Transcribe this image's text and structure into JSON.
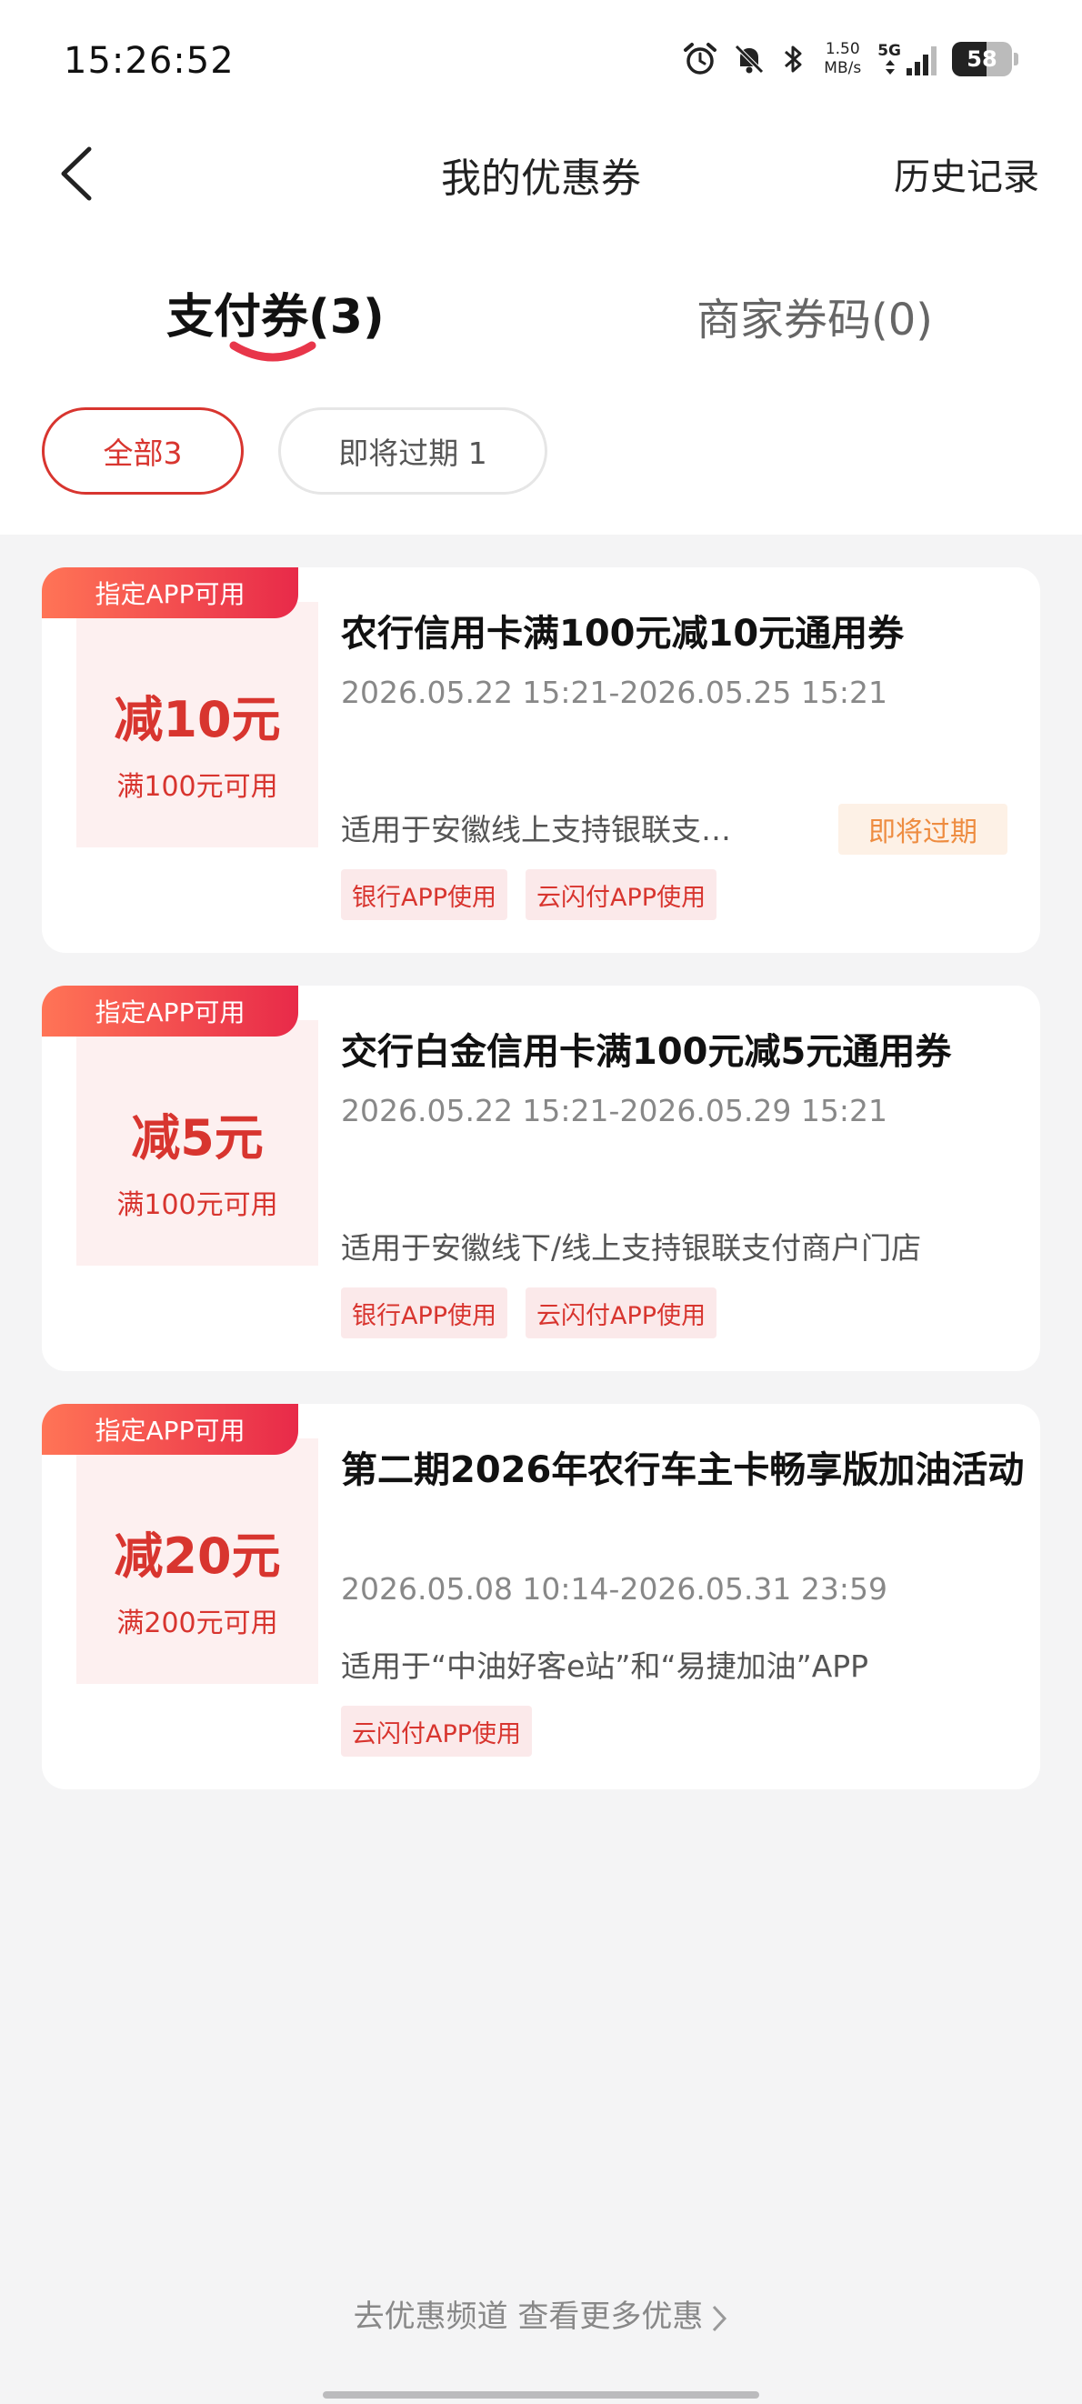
{
  "status_bar": {
    "time": "15:26:52",
    "net_speed_value": "1.50",
    "net_speed_unit": "MB/s",
    "network_type": "5G",
    "battery": "58",
    "battery_level_percent": 58
  },
  "header": {
    "title": "我的优惠券",
    "history_label": "历史记录"
  },
  "tabs": [
    {
      "label": "支付券(3)",
      "active": true
    },
    {
      "label": "商家券码(0)",
      "active": false
    }
  ],
  "filters": [
    {
      "label": "全部3",
      "active": true
    },
    {
      "label": "即将过期 1",
      "active": false
    }
  ],
  "coupons": [
    {
      "tag": "指定APP可用",
      "amount": "减10元",
      "condition": "满100元可用",
      "title": "农行信用卡满100元减10元通用券",
      "validity": "2026.05.22  15:21-2026.05.25  15:21",
      "scope": "适用于安徽线上支持银联支…",
      "badge": "即将过期",
      "channels": [
        "银行APP使用",
        "云闪付APP使用"
      ]
    },
    {
      "tag": "指定APP可用",
      "amount": "减5元",
      "condition": "满100元可用",
      "title": "交行白金信用卡满100元减5元通用券",
      "validity": "2026.05.22  15:21-2026.05.29  15:21",
      "scope": "适用于安徽线下/线上支持银联支付商户门店",
      "channels": [
        "银行APP使用",
        "云闪付APP使用"
      ]
    },
    {
      "tag": "指定APP可用",
      "amount": "减20元",
      "condition": "满200元可用",
      "title": "第二期2026年农行车主卡畅享版加油活动",
      "validity": "2026.05.08  10:14-2026.05.31  23:59",
      "scope": "适用于“中油好客e站”和“易捷加油”APP",
      "channels": [
        "云闪付APP使用"
      ]
    }
  ],
  "footer": {
    "more_label": "去优惠频道 查看更多优惠"
  },
  "colors": {
    "accent": "#d8352f",
    "tag_gradient_start": "#ff7456",
    "tag_gradient_end": "#e82a49",
    "warning": "#ee8c40",
    "background": "#f4f4f5"
  }
}
